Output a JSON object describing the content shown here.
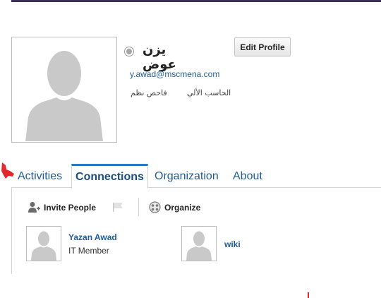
{
  "profile": {
    "name": "يزن عوض",
    "edit_button": "Edit Profile",
    "email": "y.awad@mscmena.com",
    "job_title": "فاحص نظم",
    "department": "الحاسب الألي"
  },
  "tabs": [
    {
      "label": "Activities"
    },
    {
      "label": "Connections"
    },
    {
      "label": "Organization"
    },
    {
      "label": "About"
    }
  ],
  "active_tab": "Connections",
  "toolbar": {
    "invite_label": "Invite People",
    "organize_label": "Organize"
  },
  "connections": [
    {
      "name": "Yazan Awad",
      "role": "IT Member"
    },
    {
      "name": "wiki"
    }
  ],
  "colors": {
    "link": "#1f5c99",
    "active_tab_border": "#2a78c2",
    "top_bar": "#3b3356",
    "annotation_red": "#e0282d"
  },
  "icons": {
    "status": "status-indicator-icon",
    "invite": "invite-person-icon",
    "flag": "flag-icon",
    "organize": "organize-icon",
    "annotation": "red-arrow-icon"
  }
}
